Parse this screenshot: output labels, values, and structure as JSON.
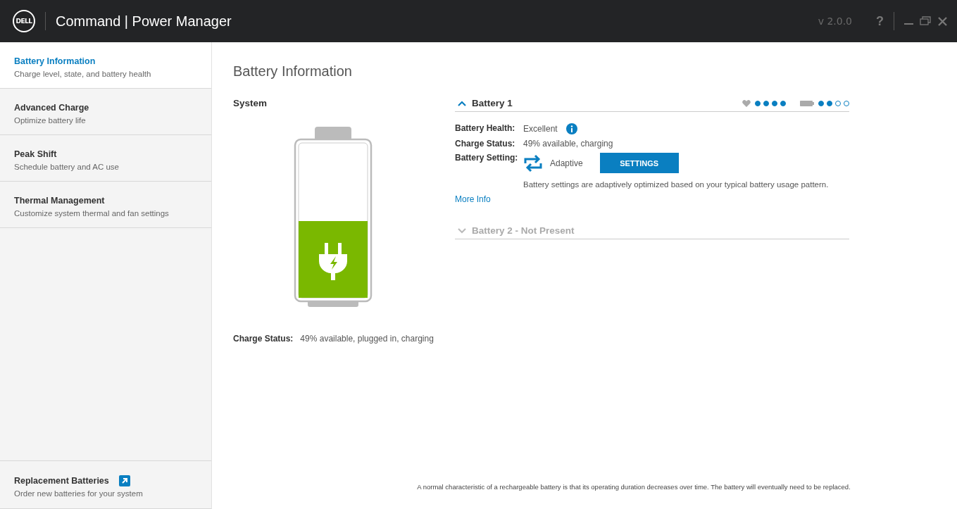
{
  "window": {
    "logo": "DELL",
    "title": "Command | Power Manager",
    "version": "v 2.0.0",
    "help": "?"
  },
  "sidebar": {
    "items": [
      {
        "title": "Battery Information",
        "subtitle": "Charge level, state, and battery health",
        "selected": true
      },
      {
        "title": "Advanced Charge",
        "subtitle": "Optimize battery life",
        "selected": false
      },
      {
        "title": "Peak Shift",
        "subtitle": "Schedule battery and AC use",
        "selected": false
      },
      {
        "title": "Thermal Management",
        "subtitle": "Customize system thermal and fan settings",
        "selected": false
      }
    ],
    "bottom_item": {
      "title": "Replacement Batteries",
      "subtitle": "Order new batteries for your system",
      "selected": false
    }
  },
  "page_title": "Battery Information",
  "system": {
    "heading": "System",
    "level": 0.5,
    "charge_label": "Charge Status:",
    "charge_value": "49% available, plugged in, charging"
  },
  "batteries": [
    {
      "name": "Battery 1",
      "expanded": true,
      "health": {
        "stars": 4
      },
      "charge": {
        "stars": 2
      },
      "fields": [
        {
          "label": "Battery Health:",
          "value": "Excellent"
        },
        {
          "label": "Charge Status:",
          "value": "49% available, charging"
        },
        {
          "label": "Battery Setting:",
          "value": "Adaptive"
        }
      ],
      "button": "SETTINGS",
      "description": "Battery settings are adaptively optimized based on your typical battery usage pattern.",
      "link": "More Info"
    },
    {
      "name": "Battery 2 - Not Present",
      "expanded": false
    }
  ],
  "footer": "A normal characteristic of a rechargeable battery is that its operating duration decreases over time. The battery will eventually need to be replaced."
}
